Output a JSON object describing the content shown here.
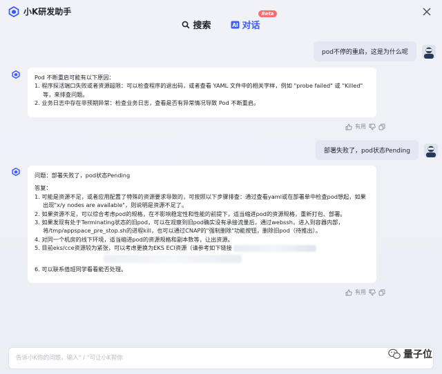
{
  "app": {
    "title": "小K研发助手"
  },
  "tabs": [
    {
      "label": "搜索",
      "active": false
    },
    {
      "label": "对话",
      "active": true,
      "badge": "Beta"
    }
  ],
  "messages": [
    {
      "role": "user",
      "text": "pod不停的重启，这是为什么呢"
    },
    {
      "role": "assistant",
      "lines": [
        "Pod 不断重启可能有以下原因：",
        "1. 程序探活端口失败或者资源超限：可以检查程序的退出码，或者查看 YAML 文件中的相关字样，例如 \"probe failed\" 或 \"Killed\" 等，来排查问题。",
        "2. 业务日志中存在非预期异常：检查业务日志，查看是否有异常情况导致 Pod 不断重启。"
      ],
      "feedback": {
        "useful": "有用"
      }
    },
    {
      "role": "user",
      "text": "部署失败了，pod状态Pending"
    },
    {
      "role": "assistant",
      "question": "问题：部署失败了，pod状态Pending",
      "answer_label": "答复：",
      "lines": [
        "1. 可能是资源不足，或者应用配置了特殊的资源要求导致的，可按照以下步骤排查：通过查看yaml或在部署单中检查pod想起，如果出现\"x/y nodes are available\"，则说明是资源不足了。",
        "2. 如果资源不足，可以综合考虑pod的规格，在不影响稳定性和性能的前提下，适当缩进pod的资源规格，重新打包、部署。",
        "3. 如果发现有处于Terminating状态的旧pod，可以在观察到旧pod确实没有承接流量后，通过webssh，进入到容器内部，将/tmp/appspace_pre_stop.sh的进程kill，也可以通过CNAP的\"强制删除\"功能按钮，删除旧pod（待推出）。",
        "4. 对同一个机房的线下环境，适当缩进pod的资源规格和副本数等，让出资源。",
        "5. 目前eks/cce资源较为紧张，可以考虑更换为EKS ECI资源（请参考如下链接",
        "6. 可以联系值班同学看看能否处理。"
      ],
      "feedback": {
        "useful": "有用"
      }
    }
  ],
  "input": {
    "placeholder": "告诉小K你的问题，输入\" / \"可让小K帮你"
  },
  "watermark": {
    "text": "量子位"
  },
  "colors": {
    "accent": "#3d5afe",
    "badge": "#ff6b6b",
    "bubble": "#e4e6f4"
  }
}
